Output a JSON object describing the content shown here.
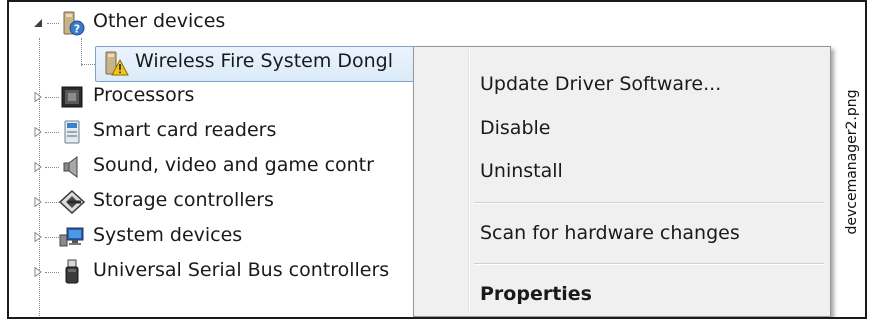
{
  "tree": {
    "other_devices": {
      "label": "Other devices",
      "icon": "unknown-device-icon",
      "expanded": true
    },
    "wireless_dongle": {
      "label": "Wireless Fire System Dongl",
      "icon": "warning-device-icon",
      "selected": true
    },
    "items": [
      {
        "label": "Processors",
        "icon": "processor-icon"
      },
      {
        "label": "Smart card readers",
        "icon": "smart-card-reader-icon"
      },
      {
        "label": "Sound, video and game contr",
        "icon": "speaker-icon"
      },
      {
        "label": "Storage controllers",
        "icon": "storage-controller-icon"
      },
      {
        "label": "System devices",
        "icon": "system-devices-icon"
      },
      {
        "label": "Universal Serial Bus controllers",
        "icon": "usb-icon"
      }
    ]
  },
  "context_menu": {
    "update_driver": "Update Driver Software...",
    "disable": "Disable",
    "uninstall": "Uninstall",
    "scan": "Scan for hardware changes",
    "properties": "Properties"
  },
  "side_caption": "devcemanager2.png",
  "colors": {
    "selection_border": "#7da2ce",
    "selection_fill": "#dbeaf9",
    "menu_background": "#f0f0f0"
  }
}
